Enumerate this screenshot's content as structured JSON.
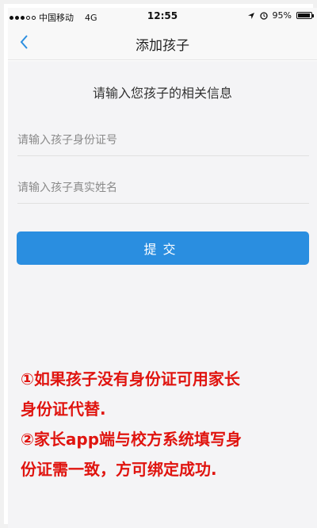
{
  "status_bar": {
    "carrier": "中国移动",
    "network": "4G",
    "time": "12:55",
    "battery": "95%",
    "battery_level": 0.95
  },
  "nav": {
    "title": "添加孩子"
  },
  "form": {
    "heading": "请输入您孩子的相关信息",
    "id_field": {
      "value": "",
      "placeholder": "请输入孩子身份证号"
    },
    "name_field": {
      "value": "",
      "placeholder": "请输入孩子真实姓名"
    },
    "submit_label": "提交"
  },
  "notes": {
    "line1": "①如果孩子没有身份证可用家长",
    "line2": "身份证代替.",
    "line3": "②家长app端与校方系统填写身",
    "line4": "份证需一致，方可绑定成功."
  },
  "colors": {
    "accent": "#2a8ee0",
    "note_red": "#e0140f"
  }
}
